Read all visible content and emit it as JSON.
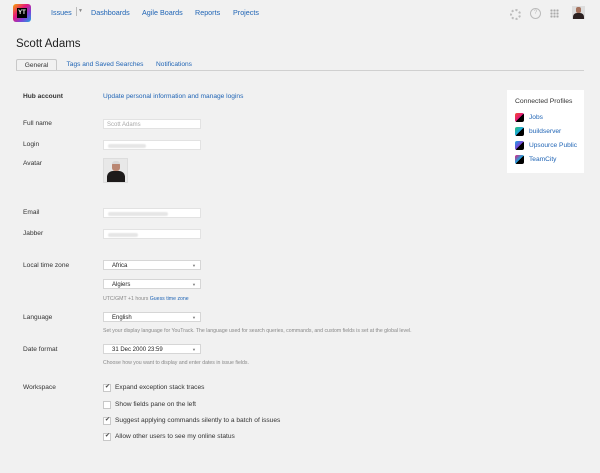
{
  "nav": {
    "logo_text": "YT",
    "issues": "Issues",
    "dashboards": "Dashboards",
    "agile_boards": "Agile Boards",
    "reports": "Reports",
    "projects": "Projects"
  },
  "page": {
    "title": "Scott Adams"
  },
  "tabs": [
    "General",
    "Tags and Saved Searches",
    "Notifications"
  ],
  "form": {
    "hub_account_label": "Hub account",
    "hub_account_link": "Update personal information and manage logins",
    "full_name_label": "Full name",
    "full_name_value": "Scott Adams",
    "login_label": "Login",
    "avatar_label": "Avatar",
    "email_label": "Email",
    "jabber_label": "Jabber",
    "timezone_label": "Local time zone",
    "timezone_region": "Africa",
    "timezone_city": "Algiers",
    "timezone_offset": "UTC/GMT +1 hours",
    "guess_time_zone": "Guess time zone",
    "language_label": "Language",
    "language_value": "English",
    "language_help": "Set your display language for YouTrack. The language used for search queries, commands, and custom fields is set at the global level.",
    "date_format_label": "Date format",
    "date_format_value": "31 Dec 2000 23:59",
    "date_format_help": "Choose how you want to display and enter dates in issue fields.",
    "workspace_label": "Workspace",
    "workspace_options": [
      {
        "label": "Expand exception stack traces",
        "checked": true
      },
      {
        "label": "Show fields pane on the left",
        "checked": false
      },
      {
        "label": "Suggest applying commands silently to a batch of issues",
        "checked": true
      },
      {
        "label": "Allow other users to see my online status",
        "checked": true
      }
    ]
  },
  "connected_profiles": {
    "title": "Connected Profiles",
    "items": [
      "Jobs",
      "buildserver",
      "Upsource Public",
      "TeamCity"
    ]
  }
}
